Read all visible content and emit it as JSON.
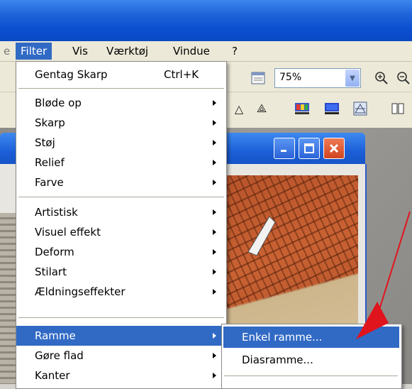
{
  "menubar": {
    "items": [
      "Filter",
      "Vis",
      "Værktøj",
      "Vindue",
      "?"
    ],
    "active": "Filter"
  },
  "toolbar": {
    "zoom_value": "75%"
  },
  "filter_menu": {
    "repeat": {
      "label": "Gentag Skarp",
      "shortcut": "Ctrl+K"
    },
    "group1": [
      "Bløde op",
      "Skarp",
      "Støj",
      "Relief",
      "Farve"
    ],
    "group2": [
      "Artistisk",
      "Visuel effekt",
      "Deform",
      "Stilart",
      "Ældningseffekter"
    ],
    "group3": [
      "Ramme",
      "Gøre flad",
      "Kanter"
    ]
  },
  "ramme_submenu": {
    "items": [
      "Enkel ramme...",
      "Diasramme..."
    ],
    "highlighted": "Enkel ramme..."
  },
  "colors": {
    "xp_blue": "#0a49c4",
    "highlight": "#316ac5",
    "menu_bg": "#ece9d8",
    "close_red": "#e1532c",
    "annotation_red": "#e0141c"
  },
  "icons": [
    "zoom-in-icon",
    "zoom-out-icon",
    "calendar-icon",
    "minimize-icon",
    "maximize-icon",
    "close-icon"
  ]
}
